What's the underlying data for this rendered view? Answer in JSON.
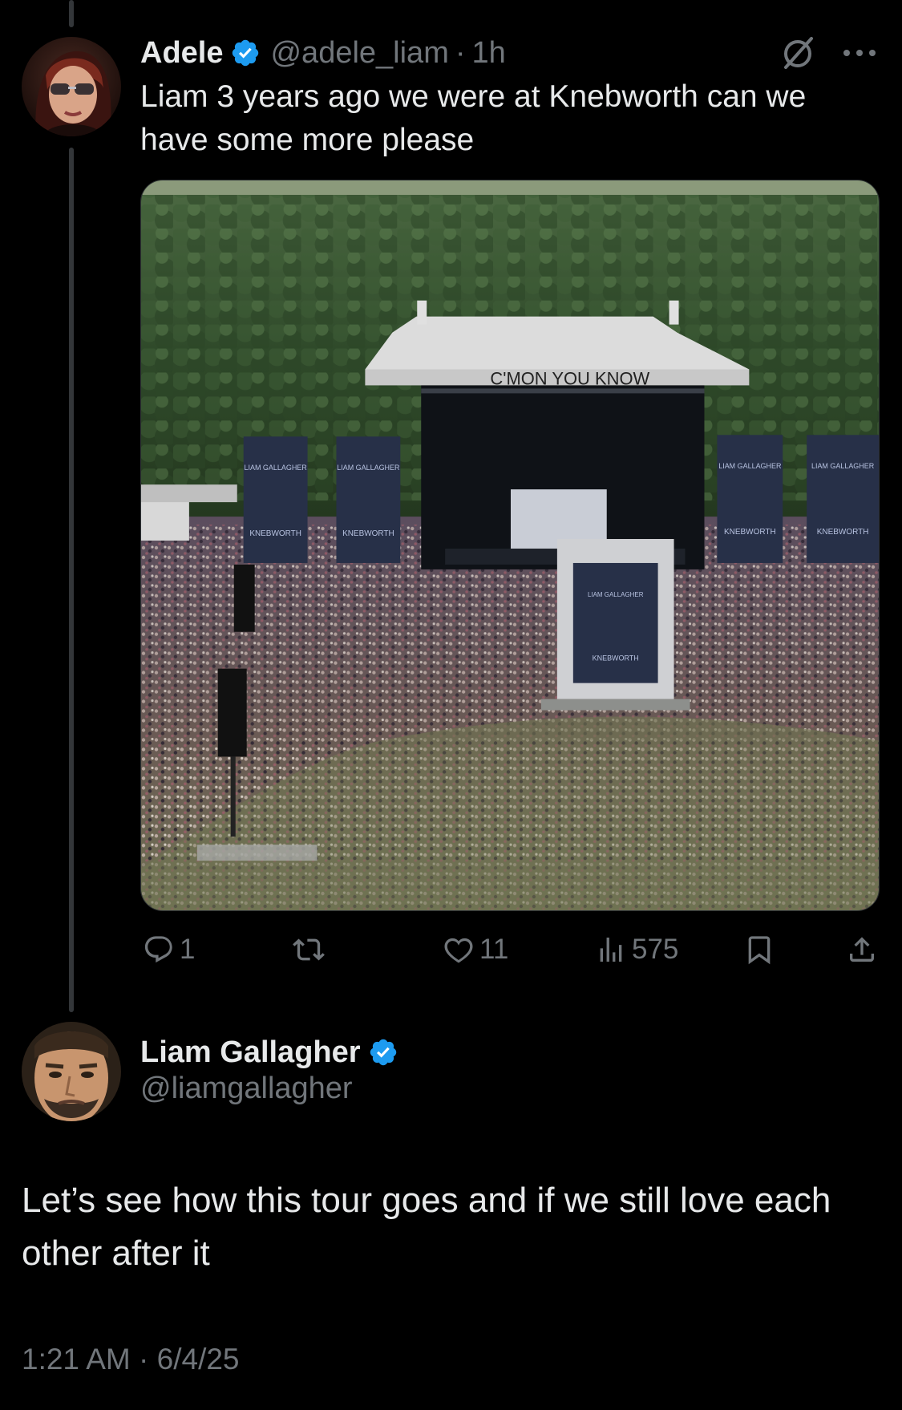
{
  "parent_tweet": {
    "display_name": "Adele",
    "verified": true,
    "handle": "@adele_liam",
    "separator": "·",
    "time_ago": "1h",
    "text": "Liam 3 years ago we were at Knebworth can we have some more please",
    "media": {
      "stage_banner_text": "C'MON YOU KNOW",
      "screen_texts": [
        "LIAM GALLAGHER",
        "KNEBWORTH"
      ]
    },
    "actions": {
      "replies": "1",
      "retweets": "",
      "likes": "11",
      "views": "575"
    },
    "icons": [
      "grok-icon",
      "more-icon",
      "reply-icon",
      "retweet-icon",
      "heart-icon",
      "views-icon",
      "bookmark-icon",
      "share-icon"
    ]
  },
  "reply_tweet": {
    "display_name": "Liam Gallagher",
    "verified": true,
    "handle": "@liamgallagher",
    "text": "Let’s see how this tour goes and if we still love each other after it",
    "timestamp": "1:21 AM · 6/4/25"
  },
  "colors": {
    "background": "#000000",
    "text_primary": "#e7e9ea",
    "text_secondary": "#71767b",
    "verified_blue": "#1d9bf0",
    "thread_line": "#333639"
  }
}
